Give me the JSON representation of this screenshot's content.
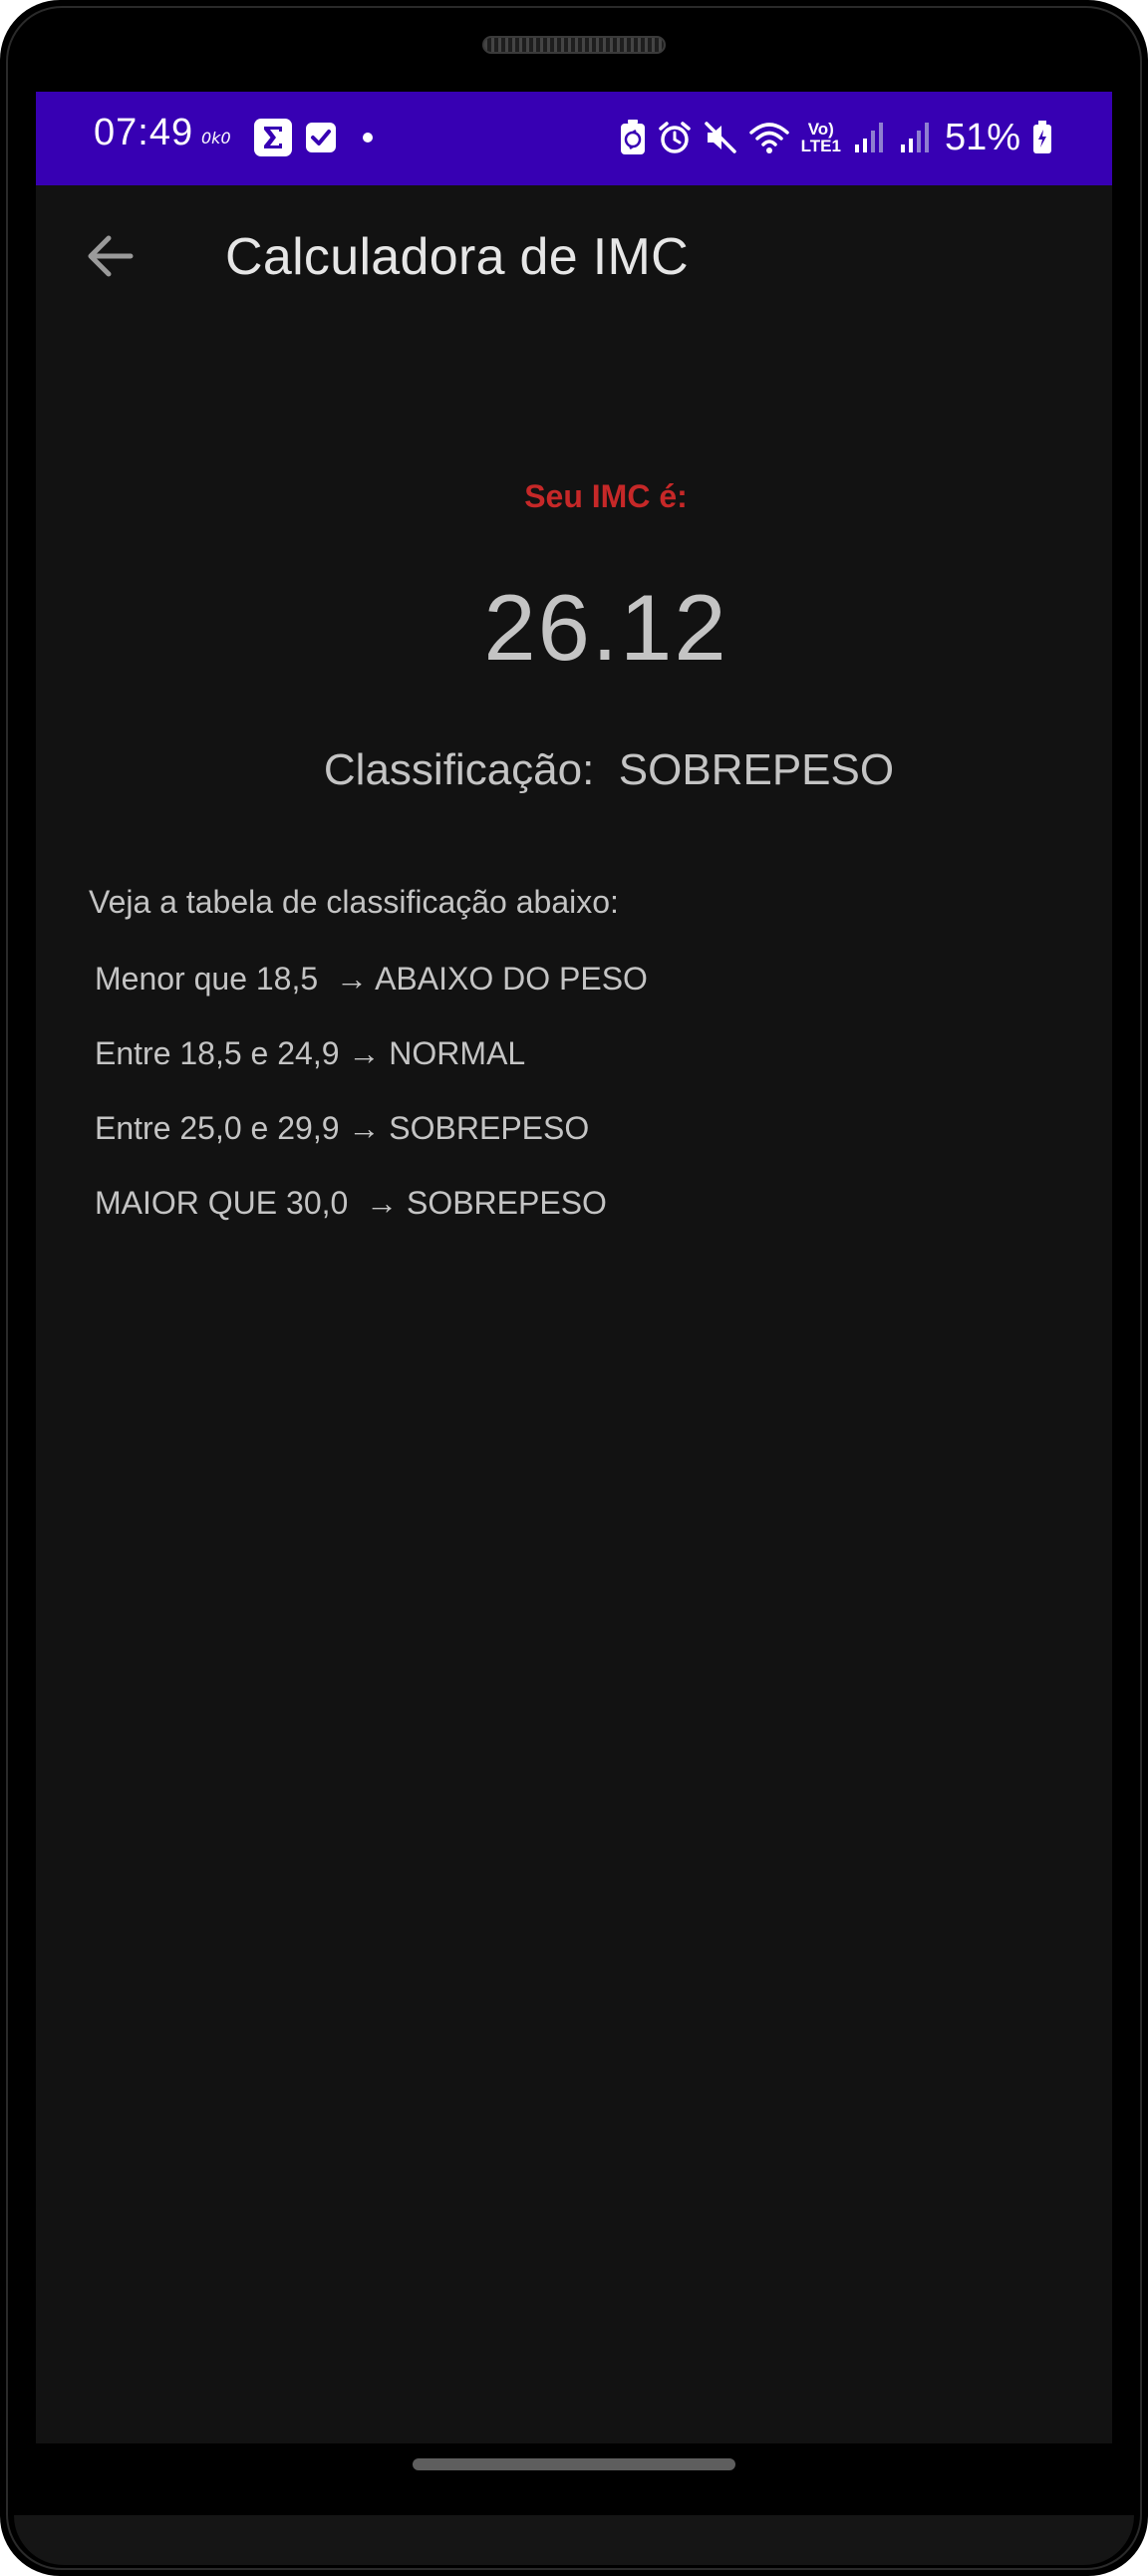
{
  "status_bar": {
    "time": "07:49",
    "battery_percent": "51%",
    "network_label_top": "Vo)",
    "network_label_bottom": "LTE1",
    "background_color": "#3700b3",
    "left_icons": [
      "0k0-icon",
      "sigma-app-icon",
      "checkbox-app-icon",
      "notification-dot-icon"
    ],
    "right_icons": [
      "battery-saver-icon",
      "alarm-icon",
      "mute-icon",
      "wifi-icon",
      "volte-lte-icon",
      "signal-icon",
      "signal-icon",
      "battery-icon"
    ]
  },
  "app_bar": {
    "title": "Calculadora de IMC",
    "back_icon": "arrow-back-icon"
  },
  "result": {
    "label": "Seu IMC é:",
    "value": "26.12",
    "classification_label": "Classificação:",
    "classification_value": "SOBREPESO",
    "label_color": "#c62828"
  },
  "table": {
    "intro": "Veja a tabela de classificação abaixo:",
    "items": [
      "Menor que 18,5  → ABAIXO DO PESO",
      "Entre 18,5 e 24,9 → NORMAL",
      "Entre 25,0 e 29,9 → SOBREPESO",
      "MAIOR QUE 30,0  → SOBREPESO"
    ]
  },
  "theme": {
    "background": "#121212",
    "text": "#c4c4c4"
  }
}
